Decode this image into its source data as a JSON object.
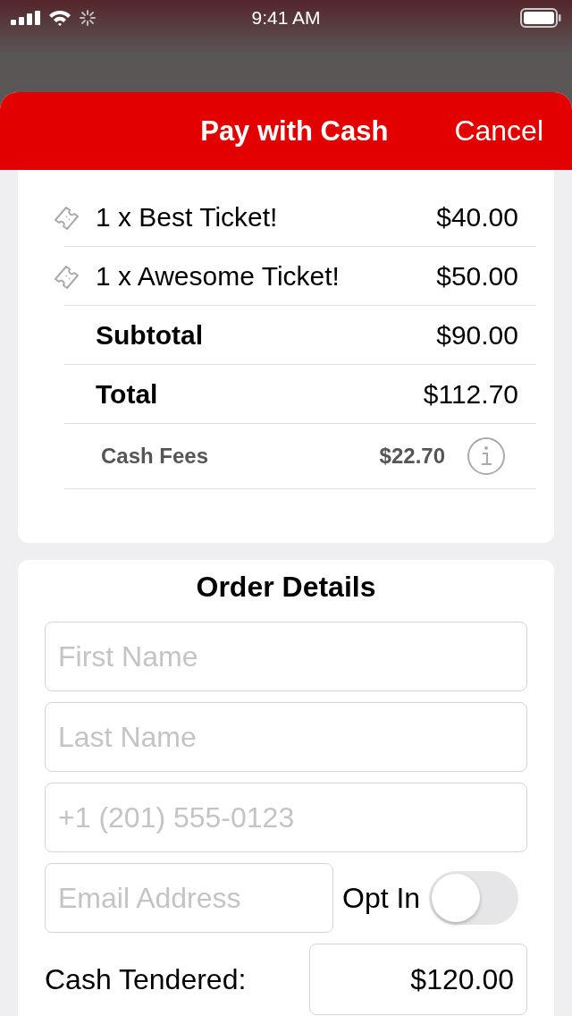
{
  "status_bar": {
    "time": "9:41 AM"
  },
  "header": {
    "title": "Pay with Cash",
    "cancel": "Cancel"
  },
  "line_items": [
    {
      "kind": "ticket",
      "label": "1 x Best Ticket!",
      "amount": "$40.00"
    },
    {
      "kind": "ticket",
      "label": "1 x Awesome Ticket!",
      "amount": "$50.00"
    },
    {
      "kind": "sum",
      "label": "Subtotal",
      "amount": "$90.00"
    },
    {
      "kind": "sum",
      "label": "Total",
      "amount": "$112.70"
    },
    {
      "kind": "fee",
      "label": "Cash Fees",
      "amount": "$22.70"
    }
  ],
  "order_details": {
    "title": "Order Details",
    "fields": [
      {
        "placeholder": "First Name"
      },
      {
        "placeholder": "Last Name"
      },
      {
        "placeholder": "+1 (201) 555-0123"
      }
    ],
    "email": {
      "placeholder": "Email Address"
    },
    "opt_in": {
      "label": "Opt In",
      "on": false
    },
    "cash_tendered": {
      "label": "Cash Tendered:",
      "value": "$120.00"
    }
  }
}
